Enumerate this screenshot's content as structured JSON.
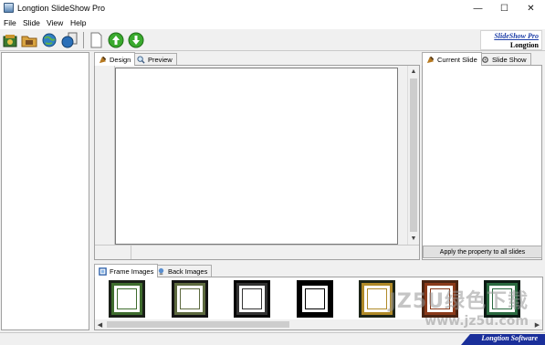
{
  "window": {
    "title": "Longtion SlideShow Pro",
    "controls": {
      "minimize": "—",
      "maximize": "☐",
      "close": "✕"
    }
  },
  "menu": [
    "File",
    "Slide",
    "View",
    "Help"
  ],
  "toolbar": {
    "icons": [
      "new-project-icon",
      "open-folder-icon",
      "globe-export-icon",
      "publish-icon",
      "blank-slide-icon",
      "move-up-icon",
      "move-down-icon"
    ],
    "logo": {
      "product": "SlideShow Pro",
      "vendor": "Longtion"
    }
  },
  "design_tabs": [
    {
      "label": "Design",
      "icon": "design-icon",
      "active": true
    },
    {
      "label": "Preview",
      "icon": "magnifier-icon",
      "active": false
    }
  ],
  "right_tabs": [
    {
      "label": "Current Slide",
      "icon": "slide-icon",
      "active": true
    },
    {
      "label": "Slide Show",
      "icon": "settings-icon",
      "active": false
    }
  ],
  "apply_button": "Apply the property to all slides",
  "bottom_tabs": [
    {
      "label": "Frame Images",
      "icon": "frame-icon",
      "active": true
    },
    {
      "label": "Back Images",
      "icon": "picture-icon",
      "active": false
    }
  ],
  "frames": [
    {
      "border": "#1a1f18",
      "accent": "#3f6d2e"
    },
    {
      "border": "#141414",
      "accent": "#5d6a3f"
    },
    {
      "border": "#050505",
      "accent": "#333333"
    },
    {
      "border": "#000000",
      "accent": "#000000"
    },
    {
      "border": "#1c2418",
      "accent": "#b08a28"
    },
    {
      "border": "#4a2412",
      "accent": "#8b3a1a"
    },
    {
      "border": "#0c1a14",
      "accent": "#2a6a40"
    }
  ],
  "status": {
    "brand": "Longtion Software"
  },
  "watermark": {
    "line1": "JZ5U绿色下载",
    "line2": "www.jz5u.com"
  },
  "colors": {
    "accent_blue": "#1a2f9a",
    "toolbar_bg": "#f0f0f0"
  }
}
